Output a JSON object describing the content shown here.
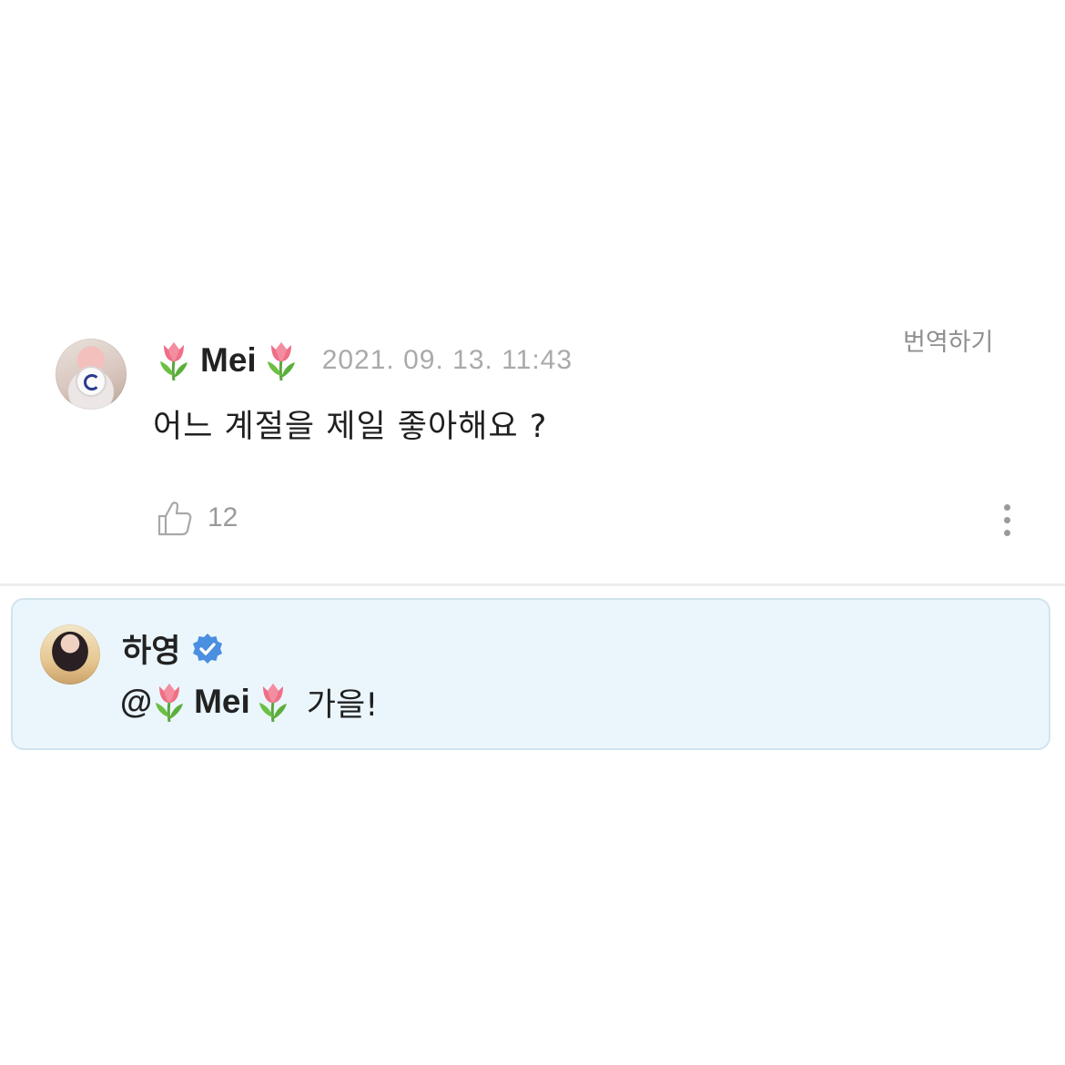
{
  "comment": {
    "author": "Mei",
    "author_emoji_icon": "tulip-icon",
    "timestamp": "2021. 09. 13. 11:43",
    "translate_label": "번역하기",
    "text": "어느 계절을 제일 좋아해요 ?",
    "like_count": "12",
    "like_icon": "thumbs-up-icon",
    "more_icon": "more-vertical-icon"
  },
  "reply": {
    "author": "하영",
    "verified_icon": "verified-badge-icon",
    "mention_prefix": "@",
    "mention_name": "Mei",
    "text": "가을!",
    "background_color": "#ebf6fc",
    "border_color": "#d0e4ef",
    "verified_color": "#4a8fe0"
  }
}
